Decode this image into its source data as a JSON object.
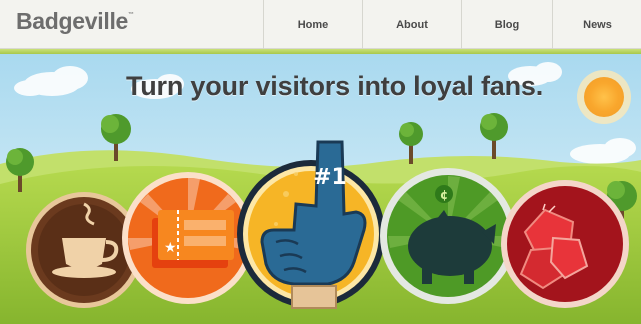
{
  "header": {
    "logo": "Badgeville",
    "logo_tm": "™",
    "nav": [
      {
        "label": "Home"
      },
      {
        "label": "About"
      },
      {
        "label": "Blog"
      },
      {
        "label": "News"
      }
    ]
  },
  "hero": {
    "headline": "Turn your visitors into loyal fans.",
    "badges": [
      {
        "icon": "coffee-cup-icon"
      },
      {
        "icon": "ticket-icon"
      },
      {
        "icon": "foam-finger-icon",
        "label": "#1"
      },
      {
        "icon": "piggy-bank-icon",
        "coin": "¢"
      },
      {
        "icon": "ruby-gems-icon"
      }
    ]
  },
  "colors": {
    "sky": "#bfe3f3",
    "grass": "#9cc83d",
    "brown_badge": "#6b3a1e",
    "orange_badge": "#f06a1c",
    "yellow_badge": "#f6b526",
    "green_badge": "#4e9a26",
    "red_badge": "#a3141c",
    "finger_blue": "#2a6a95"
  }
}
